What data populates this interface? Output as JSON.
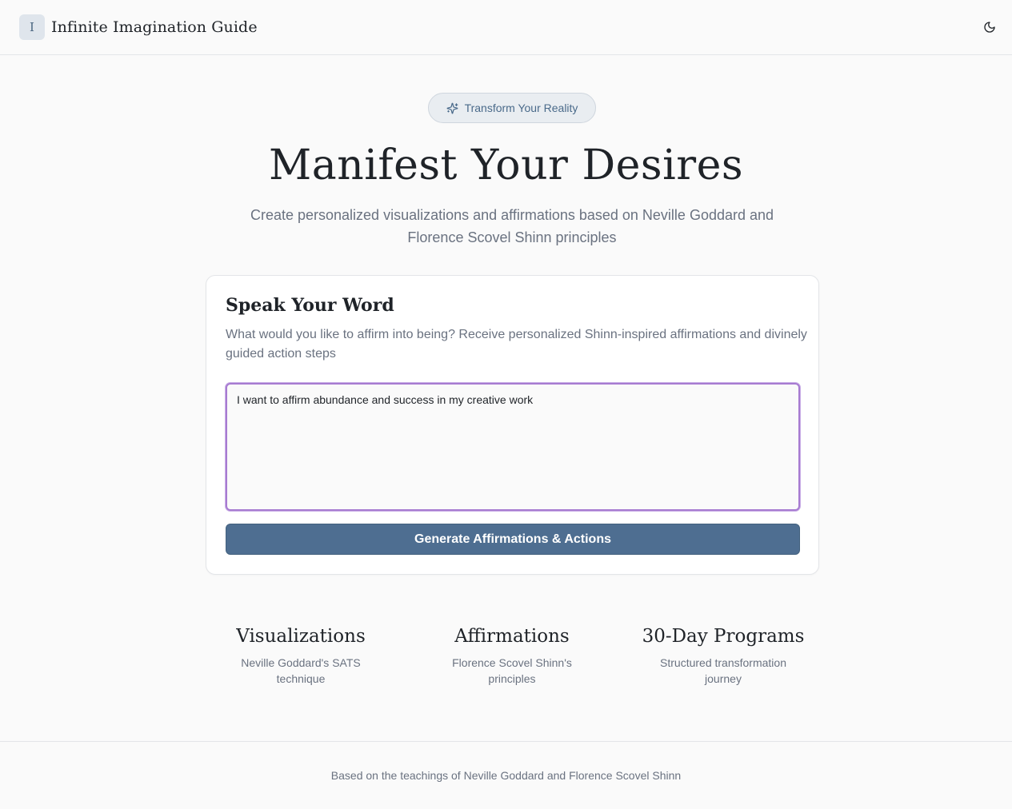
{
  "header": {
    "logo_letter": "I",
    "app_title": "Infinite Imagination Guide",
    "theme_toggle_icon": "moon-icon"
  },
  "hero": {
    "badge_icon": "sparkles-icon",
    "badge_label": "Transform Your Reality",
    "title": "Manifest Your Desires",
    "subtitle": "Create personalized visualizations and affirmations based on Neville Goddard and Florence Scovel Shinn principles"
  },
  "card": {
    "title": "Speak Your Word",
    "description": "What would you like to affirm into being? Receive personalized Shinn-inspired affirmations and divinely guided action steps",
    "input_value": "I want to affirm abundance and success in my creative work",
    "button_label": "Generate Affirmations & Actions"
  },
  "features": [
    {
      "title": "Visualizations",
      "description": "Neville Goddard's SATS technique"
    },
    {
      "title": "Affirmations",
      "description": "Florence Scovel Shinn's principles"
    },
    {
      "title": "30-Day Programs",
      "description": "Structured transformation journey"
    }
  ],
  "footer": {
    "text": "Based on the teachings of Neville Goddard and Florence Scovel Shinn"
  },
  "colors": {
    "accent": "#4e6e91",
    "focus_ring": "#a77bd1",
    "background": "#fafafa"
  }
}
